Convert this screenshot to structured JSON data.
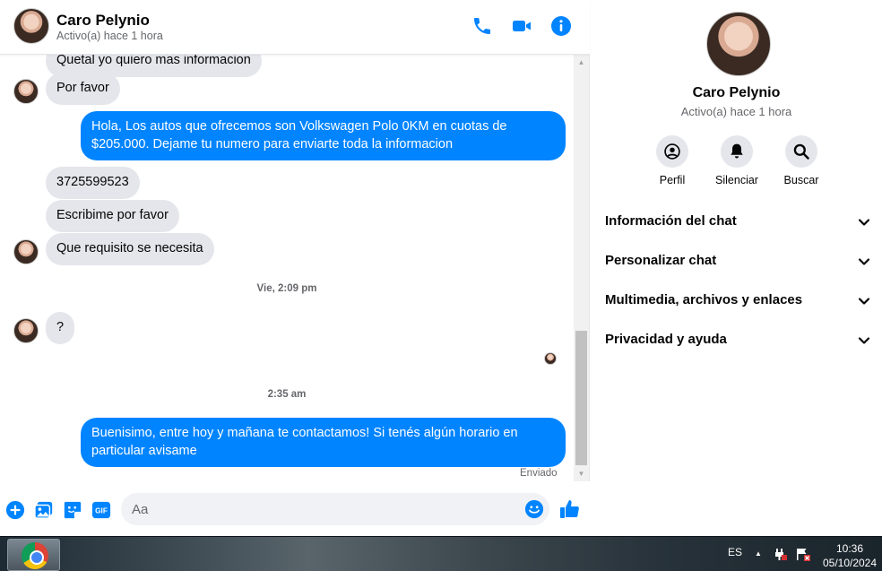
{
  "contact": {
    "name": "Caro Pelynio",
    "status": "Activo(a) hace 1 hora"
  },
  "messages": {
    "m0": "Quetal yo quiero mas informacion",
    "m1": "Por favor",
    "m2": "Hola, Los autos que ofrecemos son Volkswagen Polo 0KM en cuotas de $205.000. Dejame tu numero para enviarte toda la informacion",
    "m3": "3725599523",
    "m4": "Escribime por favor",
    "m5": "Que requisito se necesita",
    "ts1": "Vie, 2:09 pm",
    "m6": "?",
    "ts2": "2:35 am",
    "m7": "Buenisimo, entre hoy y mañana te contactamos! Si tenés algún horario en particular avisame",
    "sent_status": "Enviado"
  },
  "composer": {
    "placeholder": "Aa",
    "gif_label": "GIF"
  },
  "panel": {
    "actions": {
      "profile": "Perfil",
      "mute": "Silenciar",
      "search": "Buscar"
    },
    "sections": {
      "chat_info": "Información del chat",
      "customize": "Personalizar chat",
      "media": "Multimedia, archivos y enlaces",
      "privacy": "Privacidad y ayuda"
    }
  },
  "taskbar": {
    "language": "ES",
    "time": "10:36",
    "date": "05/10/2024"
  },
  "colors": {
    "accent": "#0084ff",
    "incoming_bubble": "#e4e6eb",
    "secondary_text": "#65676b"
  }
}
